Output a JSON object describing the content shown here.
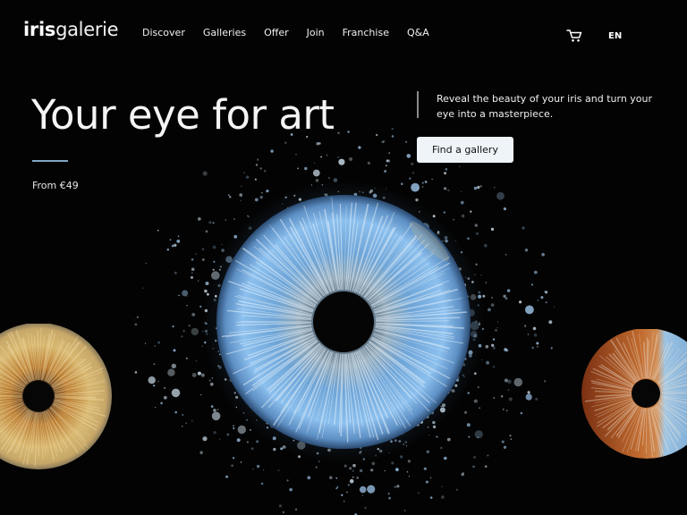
{
  "brand": {
    "logo_bold": "iris",
    "logo_light": "galerie"
  },
  "nav": {
    "items": [
      {
        "label": "Discover"
      },
      {
        "label": "Galleries"
      },
      {
        "label": "Offer"
      },
      {
        "label": "Join"
      },
      {
        "label": "Franchise"
      },
      {
        "label": "Q&A"
      }
    ]
  },
  "header_actions": {
    "cart_icon": "shopping-cart-icon",
    "language": "EN"
  },
  "hero": {
    "headline": "Your eye for art",
    "price_text": "From €49",
    "tagline": "Reveal the beauty of your iris and turn your eye into a masterpiece.",
    "cta_label": "Find a gallery"
  },
  "colors": {
    "background": "#030303",
    "accent_rule": "#7fa6c4",
    "cta_background": "#eef4f7",
    "iris_blue": "#7fb4e6",
    "iris_amber": "#c98a3c",
    "iris_brown": "#a8501e"
  }
}
